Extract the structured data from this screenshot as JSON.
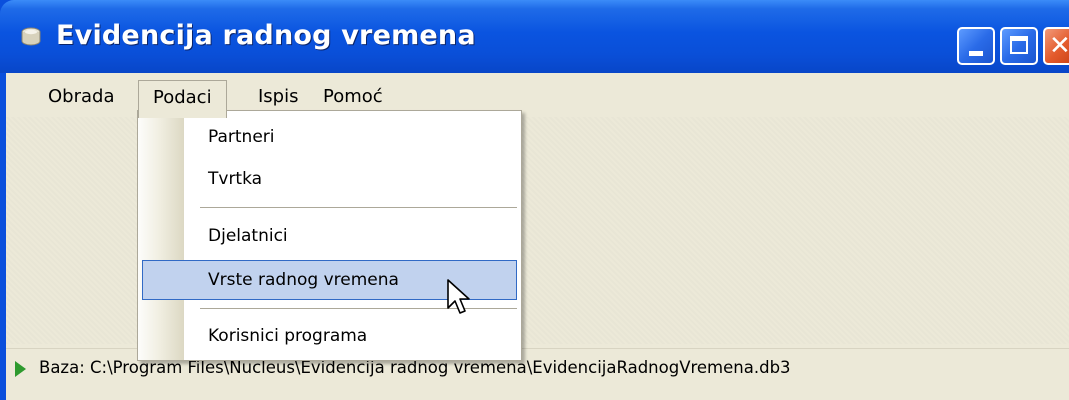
{
  "window": {
    "title": "Evidencija radnog vremena",
    "title_color": "#ffffff",
    "titlebar_color": "#0a54e0"
  },
  "menubar": {
    "items": [
      {
        "label": "Obrada"
      },
      {
        "label": "Podaci"
      },
      {
        "label": "Ispis"
      },
      {
        "label": "Pomoć"
      }
    ],
    "open_item": "Podaci"
  },
  "dropdown": {
    "items": [
      {
        "label": "Partneri"
      },
      {
        "label": "Tvrtka"
      },
      {
        "label": "Djelatnici"
      },
      {
        "label": "Vrste radnog vremena"
      },
      {
        "label": "Korisnici programa"
      }
    ],
    "highlighted": "Vrste radnog vremena",
    "highlight_color": "#c1d2ee"
  },
  "statusbar": {
    "text": "Baza: C:\\Program Files\\Nucleus\\Evidencija radnog vremena\\EvidencijaRadnogVremena.db3",
    "icon": "green-play-icon"
  },
  "colors": {
    "window_background": "#ece9d8",
    "accent": "#316ac5"
  }
}
